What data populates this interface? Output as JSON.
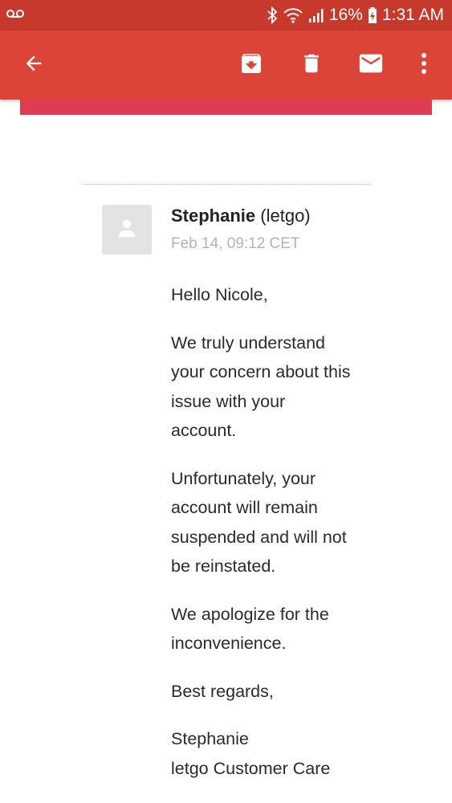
{
  "status_bar": {
    "battery": "16%",
    "time": "1:31 AM",
    "left_icon": "voicemail-icon",
    "icons": [
      "bluetooth-icon",
      "wifi-icon",
      "signal-icon",
      "battery-charging-icon"
    ]
  },
  "toolbar": {
    "back_icon": "arrow-left-icon",
    "actions": [
      "archive-icon",
      "delete-icon",
      "mark-unread-icon",
      "more-vert-icon"
    ]
  },
  "message": {
    "sender_name": "Stephanie",
    "sender_org": "(letgo)",
    "date": "Feb 14, 09:12 CET",
    "greeting": "Hello Nicole,",
    "paragraph_1": "We truly understand\nyour concern about this\nissue with your\naccount.",
    "paragraph_2": "Unfortunately, your\naccount will remain\nsuspended and will not\nbe reinstated.",
    "paragraph_3": "We apologize for the\ninconvenience.",
    "closing": "Best regards,",
    "signature_name": "Stephanie",
    "signature_team": "letgo Customer Care"
  },
  "colors": {
    "status_bar": "#c6392c",
    "toolbar": "#db4437",
    "accent_strip": "#de3c52"
  }
}
